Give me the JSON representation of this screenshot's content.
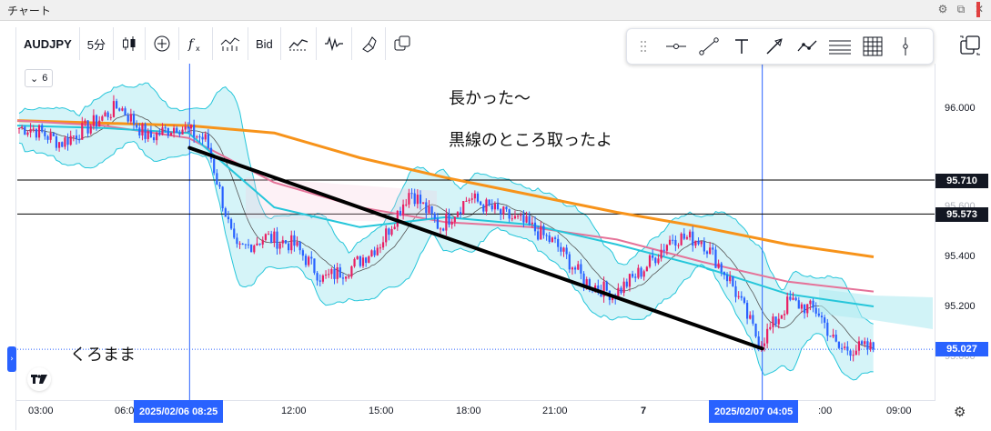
{
  "window": {
    "title": "チャート"
  },
  "toolbar": {
    "symbol": "AUDJPY",
    "interval": "5分",
    "bid_label": "Bid"
  },
  "legend": {
    "count": "6"
  },
  "annotations": {
    "line1": "長かった～",
    "line2": "黒線のところ取ったよ",
    "signature": "くろまま"
  },
  "price_axis": {
    "ticks": [
      "96.000",
      "95.400",
      "95.200"
    ],
    "faded_ticks": [
      "95.600",
      "95.000"
    ],
    "labels": [
      {
        "value": "95.710",
        "kind": "hline"
      },
      {
        "value": "95.573",
        "kind": "hline"
      },
      {
        "value": "95.027",
        "kind": "last"
      }
    ]
  },
  "time_axis": {
    "ticks": [
      "03:00",
      "06:00",
      "12:00",
      "15:00",
      "18:00",
      "21:00",
      "7",
      "09:00"
    ],
    "partial_ticks": [
      ":00"
    ],
    "crosshair_labels": [
      "2025/02/06   08:25",
      "2025/02/07   04:05"
    ]
  },
  "colors": {
    "accent": "#2962ff",
    "candle_up": "#e91e63",
    "candle_down": "#2962ff",
    "ma_orange": "#f7931a",
    "ma_pink": "#e57399",
    "ma_teal": "#26c6da",
    "band_fill": "#b2ebf2",
    "trendline": "#000000"
  },
  "chart_data": {
    "type": "candlestick",
    "instrument": "AUDJPY",
    "interval": "5分",
    "ylim": [
      94.95,
      96.18
    ],
    "x_ticks": [
      "03:00",
      "06:00",
      "12:00",
      "15:00",
      "18:00",
      "21:00",
      "7",
      "09:00"
    ],
    "y_ticks": [
      96.0,
      95.6,
      95.4,
      95.2,
      95.0
    ],
    "horizontal_lines": [
      95.71,
      95.573
    ],
    "last_price": 95.027,
    "trendline": {
      "from": {
        "time": "2025/02/06 08:25",
        "price": 95.84
      },
      "to": {
        "time": "2025/02/07 04:05",
        "price": 95.03
      }
    },
    "crosshair_times": [
      "2025/02/06 08:25",
      "2025/02/07 04:05"
    ],
    "close_path": [
      {
        "t": "2025/02/06 03:00",
        "price": 95.92
      },
      {
        "t": "2025/02/06 04:00",
        "price": 95.86
      },
      {
        "t": "2025/02/06 05:00",
        "price": 95.93
      },
      {
        "t": "2025/02/06 06:00",
        "price": 96.01
      },
      {
        "t": "2025/02/06 07:00",
        "price": 95.88
      },
      {
        "t": "2025/02/06 08:00",
        "price": 95.93
      },
      {
        "t": "2025/02/06 09:00",
        "price": 95.87
      },
      {
        "t": "2025/02/06 10:00",
        "price": 95.42
      },
      {
        "t": "2025/02/06 11:00",
        "price": 95.48
      },
      {
        "t": "2025/02/06 12:00",
        "price": 95.45
      },
      {
        "t": "2025/02/06 13:00",
        "price": 95.31
      },
      {
        "t": "2025/02/06 14:00",
        "price": 95.36
      },
      {
        "t": "2025/02/06 15:00",
        "price": 95.46
      },
      {
        "t": "2025/02/06 16:00",
        "price": 95.67
      },
      {
        "t": "2025/02/06 17:00",
        "price": 95.52
      },
      {
        "t": "2025/02/06 18:00",
        "price": 95.64
      },
      {
        "t": "2025/02/06 19:00",
        "price": 95.58
      },
      {
        "t": "2025/02/06 20:00",
        "price": 95.53
      },
      {
        "t": "2025/02/06 21:00",
        "price": 95.45
      },
      {
        "t": "2025/02/06 22:00",
        "price": 95.3
      },
      {
        "t": "2025/02/06 23:00",
        "price": 95.25
      },
      {
        "t": "2025/02/07 00:00",
        "price": 95.35
      },
      {
        "t": "2025/02/07 01:00",
        "price": 95.48
      },
      {
        "t": "2025/02/07 02:00",
        "price": 95.47
      },
      {
        "t": "2025/02/07 03:00",
        "price": 95.3
      },
      {
        "t": "2025/02/07 04:00",
        "price": 95.05
      },
      {
        "t": "2025/02/07 05:00",
        "price": 95.22
      },
      {
        "t": "2025/02/07 06:00",
        "price": 95.18
      },
      {
        "t": "2025/02/07 06:40",
        "price": 95.03
      }
    ],
    "moving_averages": [
      {
        "color": "orange",
        "values": [
          95.95,
          95.94,
          95.93,
          95.9,
          95.8,
          95.72,
          95.65,
          95.58,
          95.52,
          95.45,
          95.4
        ]
      },
      {
        "color": "pink",
        "values": [
          95.95,
          95.93,
          95.88,
          95.7,
          95.6,
          95.54,
          95.52,
          95.47,
          95.38,
          95.3,
          95.26
        ]
      },
      {
        "color": "teal",
        "values": [
          95.93,
          95.92,
          95.9,
          95.6,
          95.52,
          95.56,
          95.53,
          95.45,
          95.36,
          95.25,
          95.2
        ]
      }
    ]
  }
}
